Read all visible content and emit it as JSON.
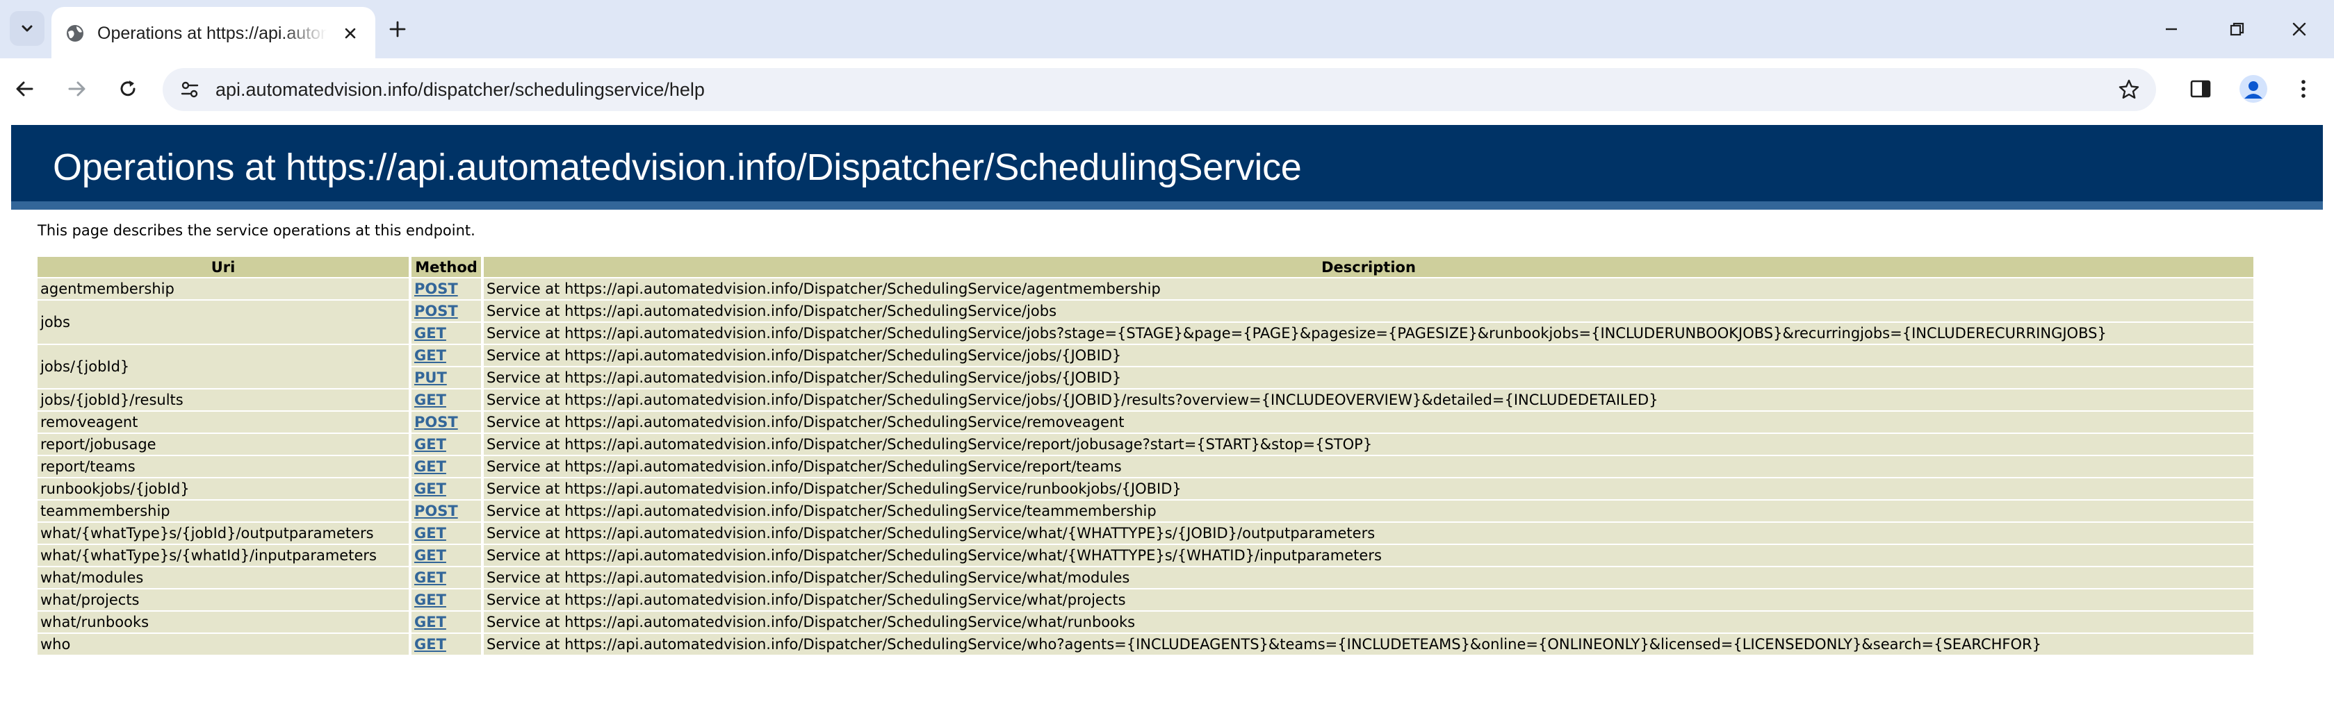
{
  "browser": {
    "tab": {
      "title": "Operations at https://api.automatedvision.info/Dispatcher/SchedulingService"
    },
    "omnibox": {
      "url": "api.automatedvision.info/dispatcher/schedulingservice/help"
    },
    "icons": {
      "tab_search": "chevron-down-icon",
      "favicon": "globe-icon",
      "tab_close": "close-icon",
      "new_tab": "plus-icon",
      "minimize": "minimize-icon",
      "restore": "restore-icon",
      "close_window": "close-icon",
      "back": "arrow-left-icon",
      "forward": "arrow-right-icon",
      "reload": "reload-icon",
      "site_info": "tune-icon",
      "bookmark": "star-icon",
      "side_panel": "side-panel-icon",
      "profile": "profile-icon",
      "menu": "kebab-menu-icon"
    },
    "colors": {
      "tabstrip": "#dfe7f6",
      "omnibox": "#eef1f8"
    }
  },
  "page": {
    "heading": "Operations at https://api.automatedvision.info/Dispatcher/SchedulingService",
    "intro": "This page describes the service operations at this endpoint.",
    "table": {
      "headers": {
        "uri": "Uri",
        "method": "Method",
        "description": "Description"
      },
      "rows": [
        {
          "uri": "agentmembership",
          "methods": [
            {
              "method": "POST",
              "description": "Service at https://api.automatedvision.info/Dispatcher/SchedulingService/agentmembership"
            }
          ]
        },
        {
          "uri": "jobs",
          "methods": [
            {
              "method": "POST",
              "description": "Service at https://api.automatedvision.info/Dispatcher/SchedulingService/jobs"
            },
            {
              "method": "GET",
              "description": "Service at https://api.automatedvision.info/Dispatcher/SchedulingService/jobs?stage={STAGE}&page={PAGE}&pagesize={PAGESIZE}&runbookjobs={INCLUDERUNBOOKJOBS}&recurringjobs={INCLUDERECURRINGJOBS}"
            }
          ]
        },
        {
          "uri": "jobs/{jobId}",
          "methods": [
            {
              "method": "GET",
              "description": "Service at https://api.automatedvision.info/Dispatcher/SchedulingService/jobs/{JOBID}"
            },
            {
              "method": "PUT",
              "description": "Service at https://api.automatedvision.info/Dispatcher/SchedulingService/jobs/{JOBID}"
            }
          ]
        },
        {
          "uri": "jobs/{jobId}/results",
          "methods": [
            {
              "method": "GET",
              "description": "Service at https://api.automatedvision.info/Dispatcher/SchedulingService/jobs/{JOBID}/results?overview={INCLUDEOVERVIEW}&detailed={INCLUDEDETAILED}"
            }
          ]
        },
        {
          "uri": "removeagent",
          "methods": [
            {
              "method": "POST",
              "description": "Service at https://api.automatedvision.info/Dispatcher/SchedulingService/removeagent"
            }
          ]
        },
        {
          "uri": "report/jobusage",
          "methods": [
            {
              "method": "GET",
              "description": "Service at https://api.automatedvision.info/Dispatcher/SchedulingService/report/jobusage?start={START}&stop={STOP}"
            }
          ]
        },
        {
          "uri": "report/teams",
          "methods": [
            {
              "method": "GET",
              "description": "Service at https://api.automatedvision.info/Dispatcher/SchedulingService/report/teams"
            }
          ]
        },
        {
          "uri": "runbookjobs/{jobId}",
          "methods": [
            {
              "method": "GET",
              "description": "Service at https://api.automatedvision.info/Dispatcher/SchedulingService/runbookjobs/{JOBID}"
            }
          ]
        },
        {
          "uri": "teammembership",
          "methods": [
            {
              "method": "POST",
              "description": "Service at https://api.automatedvision.info/Dispatcher/SchedulingService/teammembership"
            }
          ]
        },
        {
          "uri": "what/{whatType}s/{jobId}/outputparameters",
          "methods": [
            {
              "method": "GET",
              "description": "Service at https://api.automatedvision.info/Dispatcher/SchedulingService/what/{WHATTYPE}s/{JOBID}/outputparameters"
            }
          ]
        },
        {
          "uri": "what/{whatType}s/{whatId}/inputparameters",
          "methods": [
            {
              "method": "GET",
              "description": "Service at https://api.automatedvision.info/Dispatcher/SchedulingService/what/{WHATTYPE}s/{WHATID}/inputparameters"
            }
          ]
        },
        {
          "uri": "what/modules",
          "methods": [
            {
              "method": "GET",
              "description": "Service at https://api.automatedvision.info/Dispatcher/SchedulingService/what/modules"
            }
          ]
        },
        {
          "uri": "what/projects",
          "methods": [
            {
              "method": "GET",
              "description": "Service at https://api.automatedvision.info/Dispatcher/SchedulingService/what/projects"
            }
          ]
        },
        {
          "uri": "what/runbooks",
          "methods": [
            {
              "method": "GET",
              "description": "Service at https://api.automatedvision.info/Dispatcher/SchedulingService/what/runbooks"
            }
          ]
        },
        {
          "uri": "who",
          "methods": [
            {
              "method": "GET",
              "description": "Service at https://api.automatedvision.info/Dispatcher/SchedulingService/who?agents={INCLUDEAGENTS}&teams={INCLUDETEAMS}&online={ONLINEONLY}&licensed={LICENSEDONLY}&search={SEARCHFOR}"
            }
          ]
        }
      ]
    },
    "colors": {
      "banner_bg": "#003366",
      "banner_border": "#336699",
      "header_bg": "#cecf9c",
      "cell_bg": "#e5e5cc",
      "method_link": "#336699"
    }
  }
}
